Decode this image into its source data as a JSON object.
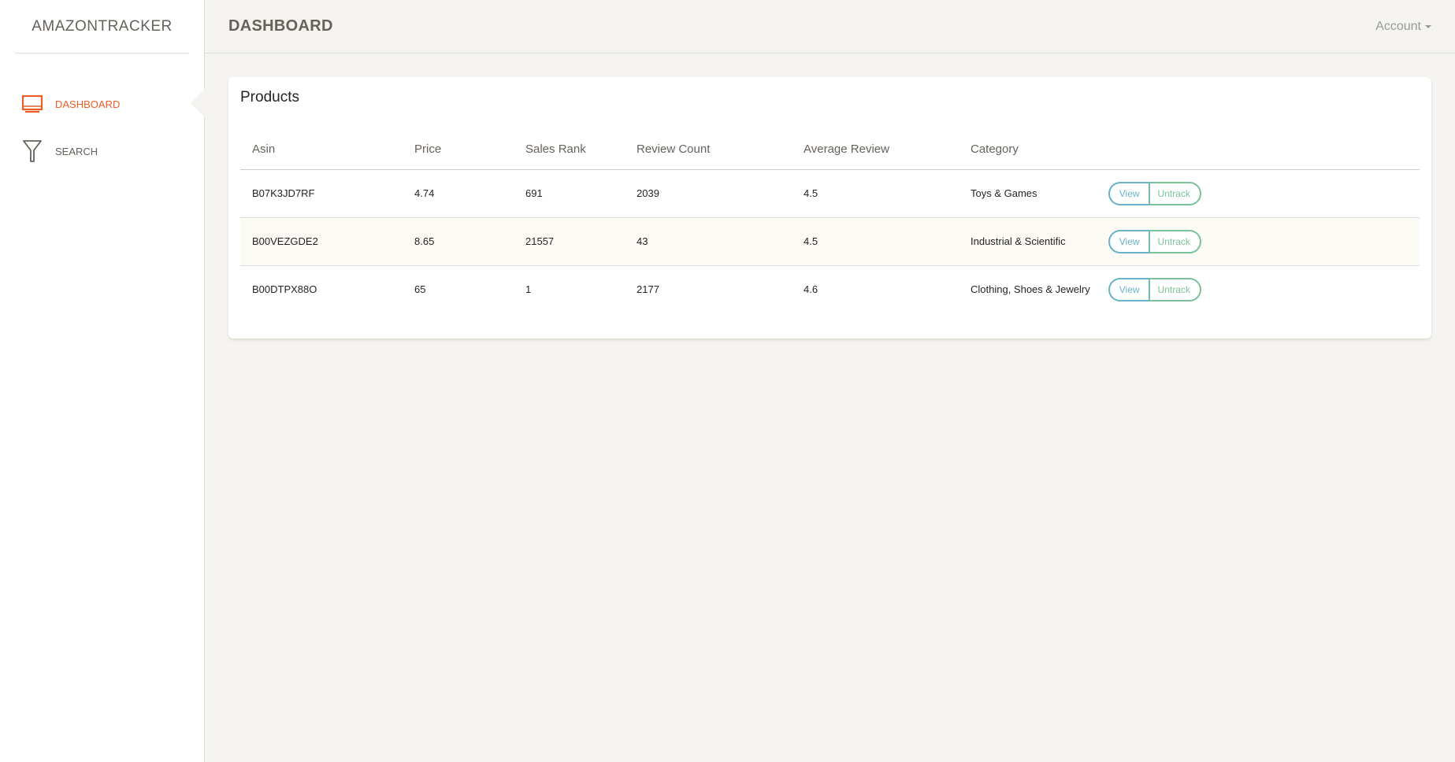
{
  "brand": {
    "name": "AMAZONTRACKER"
  },
  "sidebar": {
    "items": [
      {
        "label": "DASHBOARD",
        "icon": "monitor-icon",
        "active": true
      },
      {
        "label": "SEARCH",
        "icon": "filter-icon",
        "active": false
      }
    ]
  },
  "header": {
    "title": "DASHBOARD",
    "account_label": "Account"
  },
  "products": {
    "title": "Products",
    "columns": [
      "Asin",
      "Price",
      "Sales Rank",
      "Review Count",
      "Average Review",
      "Category"
    ],
    "rows": [
      {
        "asin": "B07K3JD7RF",
        "price": "4.74",
        "sales_rank": "691",
        "review_count": "2039",
        "average_review": "4.5",
        "category": "Toys & Games",
        "view_label": "View",
        "untrack_label": "Untrack"
      },
      {
        "asin": "B00VEZGDE2",
        "price": "8.65",
        "sales_rank": "21557",
        "review_count": "43",
        "average_review": "4.5",
        "category": "Industrial & Scientific",
        "view_label": "View",
        "untrack_label": "Untrack"
      },
      {
        "asin": "B00DTPX88O",
        "price": "65",
        "sales_rank": "1",
        "review_count": "2177",
        "average_review": "4.6",
        "category": "Clothing, Shoes & Jewelry",
        "view_label": "View",
        "untrack_label": "Untrack"
      }
    ]
  },
  "colors": {
    "accent": "#eb5e28",
    "info": "#68b3c8",
    "success": "#7ac29a",
    "background": "#f4f3ef",
    "row_stripe": "#fcfaf4"
  }
}
